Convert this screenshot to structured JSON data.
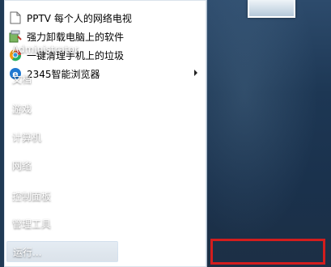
{
  "left_programs": [
    {
      "label": "PPTV 每个人的网络电视",
      "icon": "document-icon",
      "has_submenu": false
    },
    {
      "label": "强力卸载电脑上的软件",
      "icon": "uninstall-icon",
      "has_submenu": false
    },
    {
      "label": "一键清理手机上的垃圾",
      "icon": "cleaner-icon",
      "has_submenu": false
    },
    {
      "label": "2345智能浏览器",
      "icon": "browser-e-icon",
      "has_submenu": true
    }
  ],
  "right_items": [
    {
      "label": "Administrator"
    },
    {
      "label": "文档"
    },
    {
      "label": "游戏"
    },
    {
      "label": "计算机"
    },
    {
      "label": "网络"
    },
    {
      "label": "控制面板"
    },
    {
      "label": "管理工具",
      "has_submenu": true
    },
    {
      "label": "运行..."
    }
  ],
  "colors": {
    "highlight": "#d31d1d",
    "right_pane": "#1d3754",
    "left_pane": "#ffffff"
  }
}
